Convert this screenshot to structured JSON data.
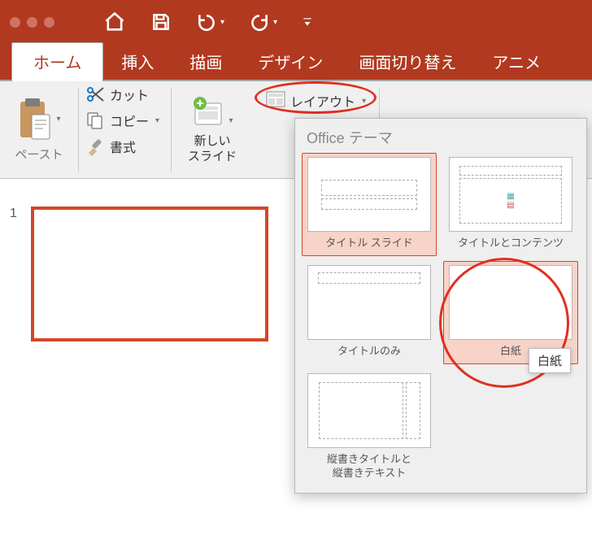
{
  "tabs": {
    "home": "ホーム",
    "insert": "挿入",
    "draw": "描画",
    "design": "デザイン",
    "transitions": "画面切り替え",
    "animations": "アニメ"
  },
  "clip": {
    "paste": "ペースト",
    "cut": "カット",
    "copy": "コピー",
    "format": "書式"
  },
  "slide": {
    "new": "新しい\nスライド",
    "layout": "レイアウト"
  },
  "thumb": {
    "num1": "1"
  },
  "flyout": {
    "header": "Office テーマ",
    "layouts": {
      "title_slide": "タイトル スライド",
      "title_content": "タイトルとコンテンツ",
      "title_only": "タイトルのみ",
      "blank": "白紙",
      "vertical": "縦書きタイトルと\n縦書きテキスト"
    }
  },
  "tooltip": {
    "blank": "白紙"
  }
}
